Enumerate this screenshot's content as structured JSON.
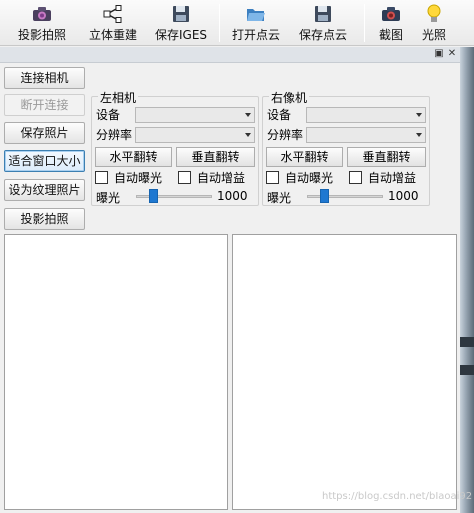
{
  "toolbar": {
    "items": [
      {
        "label": "投影拍照",
        "icon": "camera-icon"
      },
      {
        "label": "立体重建",
        "icon": "share-nodes-icon"
      },
      {
        "label": "保存IGES",
        "icon": "floppy-disk-icon"
      },
      {
        "label": "打开点云",
        "icon": "open-folder-icon"
      },
      {
        "label": "保存点云",
        "icon": "floppy-disk-icon"
      },
      {
        "label": "截图",
        "icon": "camera-icon"
      },
      {
        "label": "光照",
        "icon": "light-bulb-icon"
      }
    ]
  },
  "sidebar": {
    "buttons": [
      {
        "label": "连接相机",
        "state": "enabled"
      },
      {
        "label": "断开连接",
        "state": "disabled"
      },
      {
        "label": "保存照片",
        "state": "enabled"
      },
      {
        "label": "适合窗口大小",
        "state": "focused"
      },
      {
        "label": "设为纹理照片",
        "state": "enabled"
      },
      {
        "label": "投影拍照",
        "state": "enabled"
      }
    ]
  },
  "left_camera": {
    "title": "左相机",
    "device_label": "设备",
    "resolution_label": "分辨率",
    "flip_h": "水平翻转",
    "flip_v": "垂直翻转",
    "auto_exposure": "自动曝光",
    "auto_gain": "自动增益",
    "exposure_label": "曝光",
    "exposure_value": "1000"
  },
  "right_camera": {
    "title": "右像机",
    "device_label": "设备",
    "resolution_label": "分辨率",
    "flip_h": "水平翻转",
    "flip_v": "垂直翻转",
    "auto_exposure": "自动曝光",
    "auto_gain": "自动增益",
    "exposure_label": "曝光",
    "exposure_value": "1000"
  },
  "watermark": "https://blog.csdn.net/bIaoai92",
  "colors": {
    "accent": "#1f78d1",
    "focus_border": "#3c7fb1"
  }
}
